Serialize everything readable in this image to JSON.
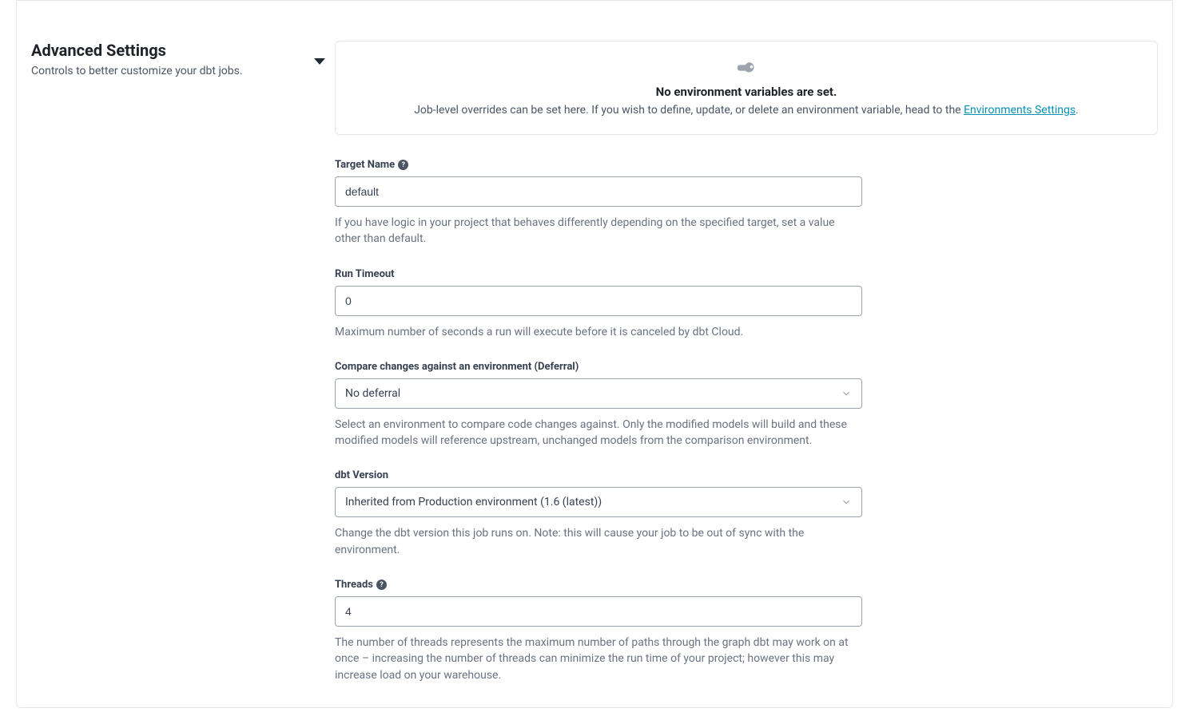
{
  "section": {
    "title": "Advanced Settings",
    "subtitle": "Controls to better customize your dbt jobs."
  },
  "env_box": {
    "title": "No environment variables are set.",
    "desc_prefix": "Job-level overrides can be set here. If you wish to define, update, or delete an environment variable, head to the ",
    "link_text": "Environments Settings",
    "desc_suffix": "."
  },
  "fields": {
    "target_name": {
      "label": "Target Name",
      "value": "default",
      "help": "If you have logic in your project that behaves differently depending on the specified target, set a value other than default."
    },
    "run_timeout": {
      "label": "Run Timeout",
      "value": "0",
      "help": "Maximum number of seconds a run will execute before it is canceled by dbt Cloud."
    },
    "deferral": {
      "label": "Compare changes against an environment (Deferral)",
      "value": "No deferral",
      "help": "Select an environment to compare code changes against. Only the modified models will build and these modified models will reference upstream, unchanged models from the comparison environment."
    },
    "dbt_version": {
      "label": "dbt Version",
      "value": "Inherited from Production environment (1.6 (latest))",
      "help": "Change the dbt version this job runs on. Note: this will cause your job to be out of sync with the environment."
    },
    "threads": {
      "label": "Threads",
      "value": "4",
      "help": "The number of threads represents the maximum number of paths through the graph dbt may work on at once – increasing the number of threads can minimize the run time of your project; however this may increase load on your warehouse."
    }
  }
}
